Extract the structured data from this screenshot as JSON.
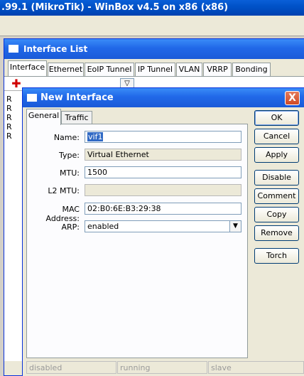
{
  "window": {
    "title": ".99.1 (MikroTik) - WinBox v4.5 on x86 (x86)"
  },
  "interface_list": {
    "title": "Interface List",
    "tabs": [
      "Interface",
      "Ethernet",
      "EoIP Tunnel",
      "IP Tunnel",
      "VLAN",
      "VRRP",
      "Bonding"
    ],
    "active_tab": "Interface",
    "add_icon": "plus-icon",
    "filter_icon": "filter-icon",
    "row_flags": [
      "R",
      "R",
      "R",
      "R",
      "R"
    ]
  },
  "dialog": {
    "title": "New Interface",
    "close_label": "X",
    "tabs": [
      "General",
      "Traffic"
    ],
    "active_tab": "General",
    "fields": {
      "name": {
        "label": "Name:",
        "value": "vif1"
      },
      "type": {
        "label": "Type:",
        "value": "Virtual Ethernet"
      },
      "mtu": {
        "label": "MTU:",
        "value": "1500"
      },
      "l2mtu": {
        "label": "L2 MTU:",
        "value": ""
      },
      "mac": {
        "label": "MAC Address:",
        "value": "02:B0:6E:B3:29:38"
      },
      "arp": {
        "label": "ARP:",
        "value": "enabled"
      }
    },
    "buttons": {
      "ok": "OK",
      "cancel": "Cancel",
      "apply": "Apply",
      "disable": "Disable",
      "comment": "Comment",
      "copy": "Copy",
      "remove": "Remove",
      "torch": "Torch"
    },
    "status": [
      "disabled",
      "running",
      "slave"
    ]
  },
  "colors": {
    "title_bar": "#2168e8",
    "close_button": "#d04a24",
    "add_icon": "#d00000"
  }
}
